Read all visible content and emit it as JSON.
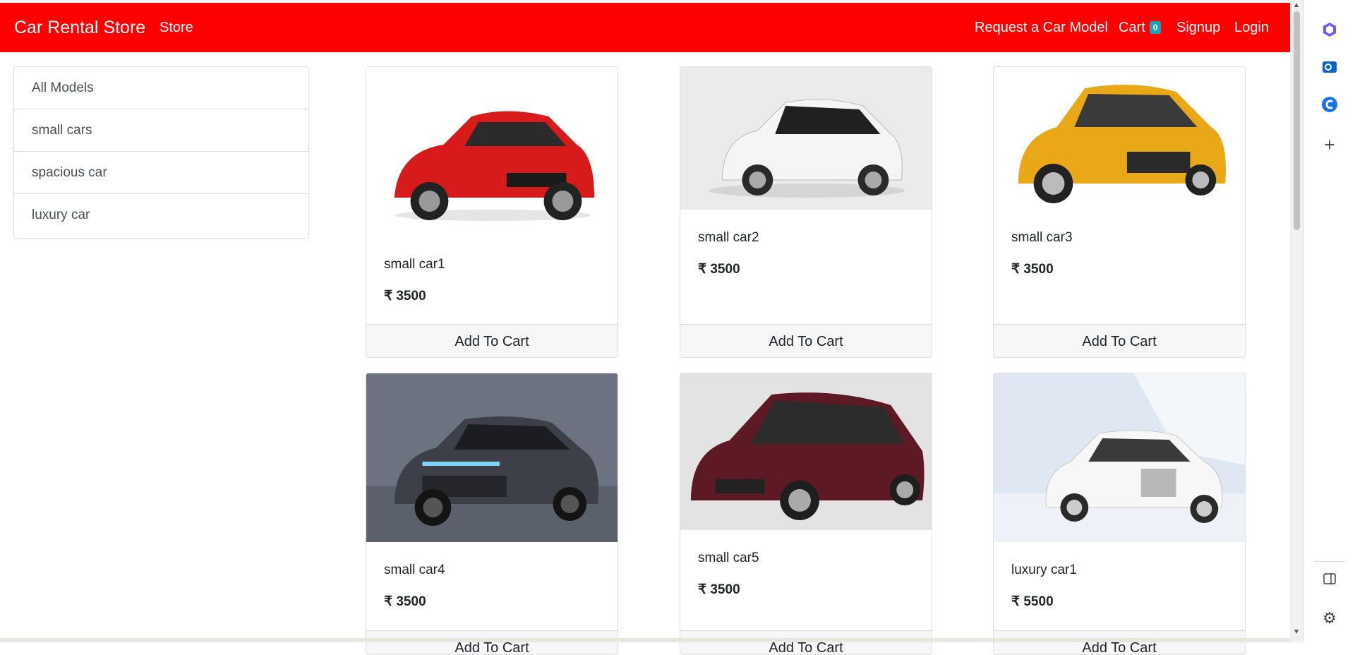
{
  "navbar": {
    "brand": "Car Rental Store",
    "store": "Store",
    "request": "Request a Car Model",
    "cart": "Cart",
    "cart_count": "0",
    "signup": "Signup",
    "login": "Login",
    "bg_color": "#ff0000"
  },
  "sidebar": {
    "items": [
      {
        "label": "All Models"
      },
      {
        "label": "small cars"
      },
      {
        "label": "spacious car"
      },
      {
        "label": "luxury car"
      }
    ]
  },
  "products": [
    {
      "name": "small car1",
      "price": "₹ 3500",
      "button": "Add To Cart",
      "image": "red-hatchback"
    },
    {
      "name": "small car2",
      "price": "₹ 3500",
      "button": "Add To Cart",
      "image": "white-hatchback"
    },
    {
      "name": "small car3",
      "price": "₹ 3500",
      "button": "Add To Cart",
      "image": "yellow-hatchback"
    },
    {
      "name": "small car4",
      "price": "₹ 3500",
      "button": "Add To Cart",
      "image": "grey-hatchback"
    },
    {
      "name": "small car5",
      "price": "₹ 3500",
      "button": "Add To Cart",
      "image": "maroon-hatchback"
    },
    {
      "name": "luxury car1",
      "price": "₹ 5500",
      "button": "Add To Cart",
      "image": "white-luxury-sedan"
    }
  ],
  "edge_panel": {
    "icons": [
      "copilot-icon",
      "outlook-icon",
      "c-app-icon",
      "plus-icon",
      "sidebar-toggle-icon",
      "settings-icon"
    ]
  }
}
